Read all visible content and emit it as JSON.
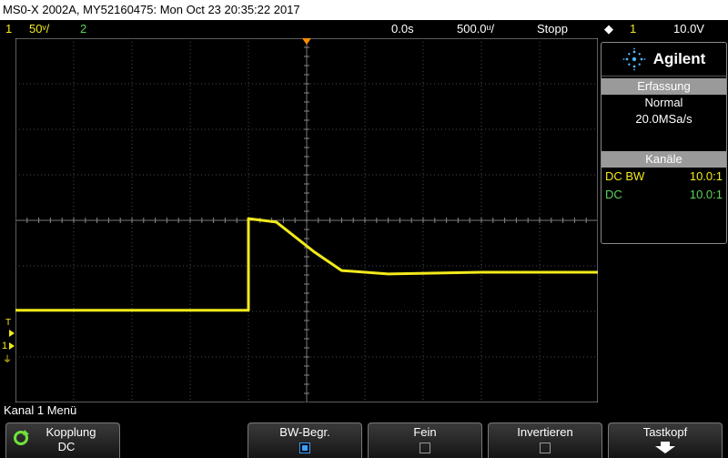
{
  "title": "MS0-X 2002A, MY52160475: Mon Oct 23 20:35:22 2017",
  "status": {
    "ch1_num": "1",
    "ch1_scale": "50ᵛ/",
    "ch2_num": "2",
    "time_ref": "0.0s",
    "time_scale": "500.0ᵘ/",
    "run_state": "Stopp",
    "trigger_source": "1",
    "trigger_level": "10.0V"
  },
  "markers": {
    "trigger": "T",
    "channel": "1"
  },
  "panel": {
    "brand": "Agilent",
    "acquisition_header": "Erfassung",
    "acquisition_mode": "Normal",
    "sample_rate": "20.0MSa/s",
    "channels_header": "Kanäle",
    "channels": [
      {
        "coupling": "DC BW",
        "probe": "10.0:1",
        "color": "#f2ea1a"
      },
      {
        "coupling": "DC",
        "probe": "10.0:1",
        "color": "#5bd35b"
      }
    ]
  },
  "menu_label": "Kanal 1 Menü",
  "softkeys": [
    {
      "label": "Kopplung",
      "value": "DC"
    },
    {
      "label": "BW-Begr.",
      "checked": true
    },
    {
      "label": "Fein",
      "checked": false
    },
    {
      "label": "Invertieren",
      "checked": false
    },
    {
      "label": "Tastkopf"
    }
  ],
  "trace": {
    "color": "#f2ea1a",
    "points": [
      [
        0,
        -5.2
      ],
      [
        5,
        -5.2
      ],
      [
        5,
        0.1
      ],
      [
        5.6,
        -0.1
      ],
      [
        6.4,
        -1.8
      ],
      [
        7,
        -2.9
      ],
      [
        8,
        -3.1
      ],
      [
        10,
        -3.0
      ],
      [
        12.5,
        -3.0
      ]
    ]
  },
  "colors": {
    "ch1": "#f2ea1a",
    "ch2": "#5bd35b",
    "trigger_marker": "#ff8c00"
  }
}
